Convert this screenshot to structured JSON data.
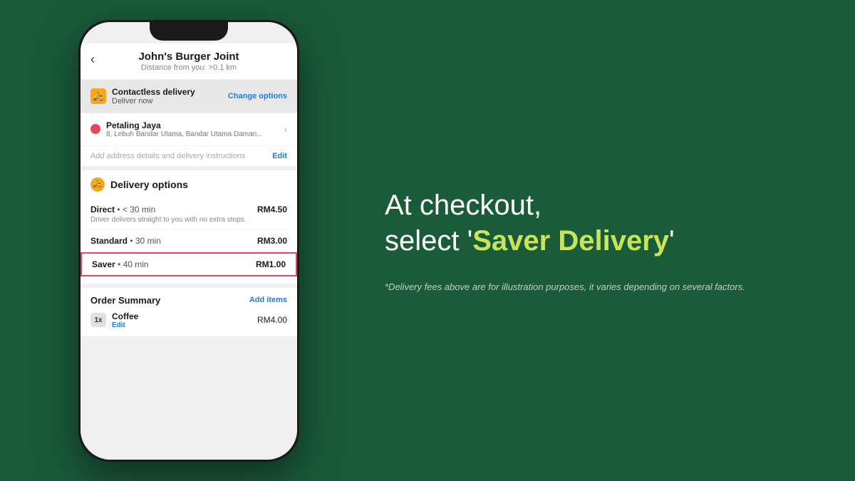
{
  "background_color": "#1a5c3a",
  "phone": {
    "header": {
      "back_label": "‹",
      "restaurant_name": "John's Burger Joint",
      "distance": "Distance from you: >0.1 km"
    },
    "delivery_row": {
      "icon": "🛵",
      "type": "Contactless delivery",
      "time": "Deliver now",
      "change_label": "Change options"
    },
    "address_row": {
      "city": "Petaling Jaya",
      "detail": "8, Lebuh Bandar Utama, Bandar Utama Daman..."
    },
    "address_instructions": {
      "placeholder": "Add address details and delivery instructions",
      "edit_label": "Edit"
    },
    "delivery_options": {
      "section_title": "Delivery options",
      "options": [
        {
          "name": "Direct",
          "time_separator": "•",
          "time": "< 30 min",
          "price": "RM4.50",
          "desc": "Driver delivers straight to you with no extra stops."
        },
        {
          "name": "Standard",
          "time_separator": "•",
          "time": "30 min",
          "price": "RM3.00",
          "desc": ""
        },
        {
          "name": "Saver",
          "time_separator": "•",
          "time": "40 min",
          "price": "RM1.00",
          "desc": "",
          "highlighted": true
        }
      ]
    },
    "order_summary": {
      "title": "Order Summary",
      "add_items_label": "Add items",
      "items": [
        {
          "qty": "1x",
          "name": "Coffee",
          "price": "RM4.00",
          "edit_label": "Edit"
        }
      ]
    }
  },
  "right_panel": {
    "line1": "At checkout,",
    "line2_prefix": "select '",
    "line2_highlight": "Saver Delivery",
    "line2_suffix": "'",
    "disclaimer": "*Delivery fees above are for illustration purposes, it varies depending on several factors."
  }
}
